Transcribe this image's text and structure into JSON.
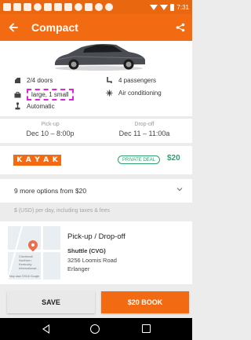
{
  "status_bar": {
    "time": "7:31"
  },
  "app_bar": {
    "title": "Compact",
    "back_icon": "arrow-left-icon",
    "share_icon": "share-icon"
  },
  "features": {
    "doors": "2/4 doors",
    "passengers": "4 passengers",
    "bags": "large, 1 small",
    "ac": "Air conditioning",
    "transmission": "Automatic"
  },
  "pickup": {
    "label": "Pick-up",
    "value": "Dec 10 – 8:00p"
  },
  "dropoff": {
    "label": "Drop-off",
    "value": "Dec 11 – 11:00a"
  },
  "deal": {
    "logo_letters": [
      "K",
      "A",
      "Y",
      "A",
      "K"
    ],
    "badge": "PRIVATE DEAL",
    "price": "$20"
  },
  "more_options": {
    "label": "9 more options from $20"
  },
  "price_note": "$ (USD) per day, including taxes & fees",
  "pickup_card": {
    "title": "Pick-up / Drop-off",
    "location": "Shuttle (CVG)",
    "address_line1": "3256 Loomis Road",
    "address_line2": "Erlanger",
    "map_text": [
      "Cincinnati",
      "Northern",
      "Kentucky",
      "International..."
    ],
    "map_credit": "Map data ©2016 Google"
  },
  "actions": {
    "save_label": "SAVE",
    "book_label": "$20 BOOK"
  },
  "colors": {
    "brand_orange": "#f26b12",
    "deal_green": "#2e9f6d",
    "highlight": "#e41fd9"
  }
}
